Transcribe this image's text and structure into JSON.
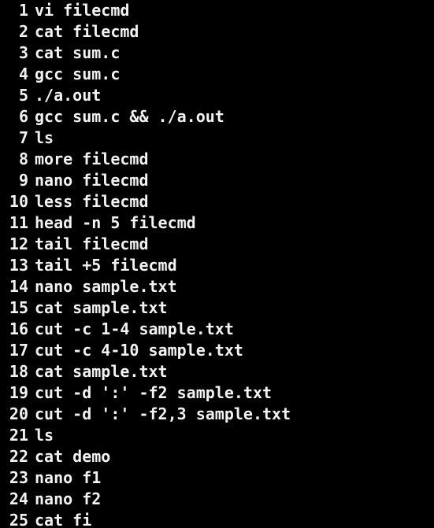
{
  "history": [
    {
      "num": "1",
      "cmd": "vi filecmd"
    },
    {
      "num": "2",
      "cmd": "cat filecmd"
    },
    {
      "num": "3",
      "cmd": "cat sum.c"
    },
    {
      "num": "4",
      "cmd": "gcc sum.c"
    },
    {
      "num": "5",
      "cmd": "./a.out"
    },
    {
      "num": "6",
      "cmd": "gcc sum.c && ./a.out"
    },
    {
      "num": "7",
      "cmd": "ls"
    },
    {
      "num": "8",
      "cmd": "more filecmd"
    },
    {
      "num": "9",
      "cmd": "nano filecmd"
    },
    {
      "num": "10",
      "cmd": "less filecmd"
    },
    {
      "num": "11",
      "cmd": "head -n 5 filecmd"
    },
    {
      "num": "12",
      "cmd": "tail filecmd"
    },
    {
      "num": "13",
      "cmd": "tail +5 filecmd"
    },
    {
      "num": "14",
      "cmd": "nano sample.txt"
    },
    {
      "num": "15",
      "cmd": "cat sample.txt"
    },
    {
      "num": "16",
      "cmd": "cut -c 1-4 sample.txt"
    },
    {
      "num": "17",
      "cmd": "cut -c 4-10 sample.txt"
    },
    {
      "num": "18",
      "cmd": "cat sample.txt"
    },
    {
      "num": "19",
      "cmd": "cut -d ':' -f2 sample.txt"
    },
    {
      "num": "20",
      "cmd": "cut -d ':' -f2,3 sample.txt"
    },
    {
      "num": "21",
      "cmd": "ls"
    },
    {
      "num": "22",
      "cmd": "cat demo"
    },
    {
      "num": "23",
      "cmd": "nano f1"
    },
    {
      "num": "24",
      "cmd": "nano f2"
    },
    {
      "num": "25",
      "cmd": "cat fi"
    }
  ],
  "colors": {
    "background": "#000000",
    "text": "#f2f2f2"
  }
}
